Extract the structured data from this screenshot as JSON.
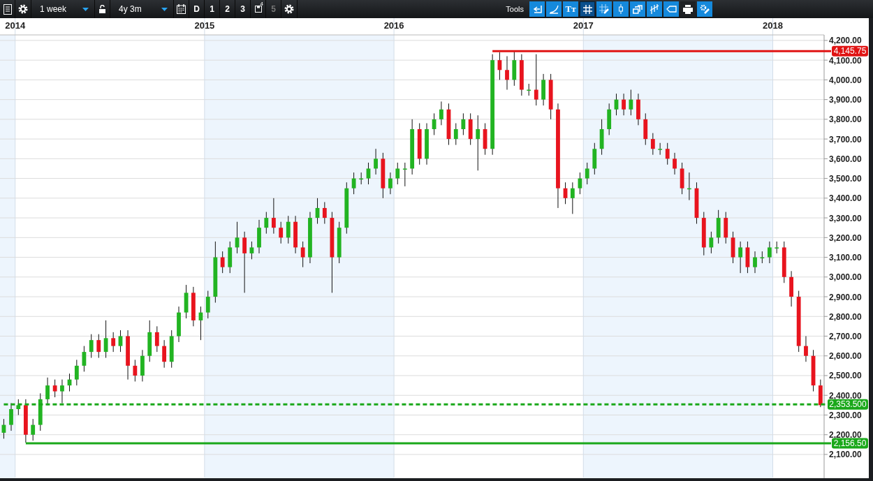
{
  "toolbar": {
    "left": [
      {
        "kind": "list"
      },
      {
        "kind": "gear"
      },
      {
        "kind": "dropdown",
        "value": "1 week"
      },
      {
        "kind": "lock"
      },
      {
        "kind": "dropdown",
        "value": "4y 3m"
      },
      {
        "kind": "calendar"
      },
      {
        "kind": "text",
        "label": "D",
        "disabled": false
      },
      {
        "kind": "text",
        "label": "1",
        "disabled": false
      },
      {
        "kind": "text",
        "label": "2",
        "disabled": false
      },
      {
        "kind": "text",
        "label": "3",
        "disabled": false
      },
      {
        "kind": "save",
        "badge": "4"
      },
      {
        "kind": "text",
        "label": "5",
        "disabled": true
      },
      {
        "kind": "gear"
      }
    ],
    "tools_label": "Tools",
    "tools": [
      {
        "kind": "back",
        "selected": false
      },
      {
        "kind": "curve",
        "selected": false
      },
      {
        "kind": "text",
        "label": "Tт",
        "selected": false
      },
      {
        "kind": "grid",
        "selected": true
      },
      {
        "kind": "grid-edit",
        "selected": false
      },
      {
        "kind": "candle",
        "selected": false
      },
      {
        "kind": "layers",
        "selected": false
      },
      {
        "kind": "bars",
        "selected": false
      },
      {
        "kind": "tag",
        "selected": false
      },
      {
        "kind": "print",
        "selected": false
      },
      {
        "kind": "settings",
        "selected": false
      }
    ]
  },
  "chart": {
    "chart_data": {
      "type": "candlestick",
      "grid": true,
      "xlim": [
        2013.92,
        2018.271
      ],
      "ylim": [
        1983,
        4228
      ],
      "xticks": [
        2014,
        2015,
        2016,
        2017,
        2018
      ],
      "yticks": [
        {
          "value": 4200,
          "label": "4,200.00"
        },
        {
          "value": 4100,
          "label": "4,100.00"
        },
        {
          "value": 4000,
          "label": "4,000.00"
        },
        {
          "value": 3900,
          "label": "3,900.00"
        },
        {
          "value": 3800,
          "label": "3,800.00"
        },
        {
          "value": 3700,
          "label": "3,700.00"
        },
        {
          "value": 3600,
          "label": "3,600.00"
        },
        {
          "value": 3500,
          "label": "3,500.00"
        },
        {
          "value": 3400,
          "label": "3,400.00"
        },
        {
          "value": 3300,
          "label": "3,300.00"
        },
        {
          "value": 3200,
          "label": "3,200.00"
        },
        {
          "value": 3100,
          "label": "3,100.00"
        },
        {
          "value": 3000,
          "label": "3,000.00"
        },
        {
          "value": 2900,
          "label": "2,900.00"
        },
        {
          "value": 2800,
          "label": "2,800.00"
        },
        {
          "value": 2700,
          "label": "2,700.00"
        },
        {
          "value": 2600,
          "label": "2,600.00"
        },
        {
          "value": 2500,
          "label": "2,500.00"
        },
        {
          "value": 2400,
          "label": "2,400.00"
        },
        {
          "value": 2300,
          "label": "2,300.00"
        },
        {
          "value": 2200,
          "label": "2,200.00"
        },
        {
          "value": 2100,
          "label": "2,100.00"
        }
      ],
      "x": [
        2013.94,
        2013.979,
        2014.017,
        2014.056,
        2014.094,
        2014.133,
        2014.171,
        2014.21,
        2014.248,
        2014.287,
        2014.325,
        2014.364,
        2014.402,
        2014.441,
        2014.479,
        2014.518,
        2014.556,
        2014.595,
        2014.633,
        2014.672,
        2014.71,
        2014.749,
        2014.787,
        2014.826,
        2014.864,
        2014.903,
        2014.941,
        2014.98,
        2015.018,
        2015.057,
        2015.095,
        2015.134,
        2015.172,
        2015.211,
        2015.249,
        2015.288,
        2015.326,
        2015.365,
        2015.403,
        2015.442,
        2015.48,
        2015.519,
        2015.557,
        2015.596,
        2015.634,
        2015.673,
        2015.711,
        2015.75,
        2015.788,
        2015.827,
        2015.865,
        2015.904,
        2015.942,
        2015.981,
        2016.019,
        2016.058,
        2016.096,
        2016.135,
        2016.173,
        2016.212,
        2016.25,
        2016.289,
        2016.327,
        2016.366,
        2016.404,
        2016.443,
        2016.481,
        2016.52,
        2016.558,
        2016.597,
        2016.635,
        2016.674,
        2016.712,
        2016.751,
        2016.789,
        2016.828,
        2016.866,
        2016.905,
        2016.943,
        2016.982,
        2017.02,
        2017.059,
        2017.097,
        2017.136,
        2017.174,
        2017.213,
        2017.251,
        2017.29,
        2017.328,
        2017.367,
        2017.405,
        2017.444,
        2017.482,
        2017.521,
        2017.559,
        2017.598,
        2017.636,
        2017.675,
        2017.713,
        2017.752,
        2017.79,
        2017.829,
        2017.867,
        2017.906,
        2017.944,
        2017.983,
        2018.021,
        2018.06,
        2018.098,
        2018.137,
        2018.175,
        2018.214,
        2018.252
      ],
      "ohlc": [
        [
          2210,
          2280,
          2180,
          2250
        ],
        [
          2250,
          2360,
          2220,
          2330
        ],
        [
          2330,
          2380,
          2300,
          2350
        ],
        [
          2350,
          2380,
          2160,
          2200
        ],
        [
          2200,
          2280,
          2170,
          2250
        ],
        [
          2250,
          2410,
          2220,
          2380
        ],
        [
          2380,
          2490,
          2350,
          2450
        ],
        [
          2450,
          2480,
          2390,
          2420
        ],
        [
          2420,
          2480,
          2360,
          2450
        ],
        [
          2450,
          2510,
          2420,
          2480
        ],
        [
          2480,
          2580,
          2450,
          2550
        ],
        [
          2550,
          2650,
          2520,
          2620
        ],
        [
          2620,
          2710,
          2590,
          2680
        ],
        [
          2680,
          2710,
          2590,
          2620
        ],
        [
          2620,
          2780,
          2590,
          2690
        ],
        [
          2690,
          2720,
          2620,
          2650
        ],
        [
          2650,
          2730,
          2620,
          2700
        ],
        [
          2700,
          2730,
          2480,
          2550
        ],
        [
          2550,
          2580,
          2470,
          2500
        ],
        [
          2500,
          2630,
          2470,
          2600
        ],
        [
          2600,
          2780,
          2570,
          2720
        ],
        [
          2720,
          2750,
          2620,
          2650
        ],
        [
          2650,
          2680,
          2540,
          2570
        ],
        [
          2570,
          2730,
          2540,
          2700
        ],
        [
          2700,
          2850,
          2670,
          2820
        ],
        [
          2820,
          2960,
          2790,
          2920
        ],
        [
          2920,
          2950,
          2750,
          2780
        ],
        [
          2780,
          2850,
          2680,
          2820
        ],
        [
          2820,
          2930,
          2790,
          2900
        ],
        [
          2900,
          3180,
          2870,
          3100
        ],
        [
          3100,
          3130,
          3020,
          3050
        ],
        [
          3050,
          3180,
          3020,
          3150
        ],
        [
          3150,
          3280,
          3120,
          3200
        ],
        [
          3200,
          3230,
          2920,
          3120
        ],
        [
          3120,
          3180,
          3090,
          3150
        ],
        [
          3150,
          3290,
          3120,
          3250
        ],
        [
          3250,
          3330,
          3220,
          3300
        ],
        [
          3300,
          3400,
          3220,
          3250
        ],
        [
          3250,
          3280,
          3170,
          3200
        ],
        [
          3200,
          3310,
          3170,
          3280
        ],
        [
          3280,
          3310,
          3120,
          3150
        ],
        [
          3150,
          3180,
          3050,
          3100
        ],
        [
          3100,
          3330,
          3070,
          3300
        ],
        [
          3300,
          3400,
          3270,
          3350
        ],
        [
          3350,
          3380,
          3270,
          3300
        ],
        [
          3300,
          3330,
          2920,
          3100
        ],
        [
          3100,
          3280,
          3070,
          3250
        ],
        [
          3250,
          3480,
          3220,
          3450
        ],
        [
          3450,
          3530,
          3420,
          3500
        ],
        [
          3500,
          3530,
          3470,
          3500
        ],
        [
          3500,
          3580,
          3470,
          3550
        ],
        [
          3550,
          3650,
          3520,
          3600
        ],
        [
          3600,
          3630,
          3400,
          3450
        ],
        [
          3450,
          3530,
          3420,
          3500
        ],
        [
          3500,
          3580,
          3470,
          3550
        ],
        [
          3550,
          3580,
          3460,
          3550
        ],
        [
          3550,
          3800,
          3520,
          3750
        ],
        [
          3750,
          3780,
          3570,
          3600
        ],
        [
          3600,
          3780,
          3570,
          3750
        ],
        [
          3750,
          3830,
          3720,
          3800
        ],
        [
          3800,
          3890,
          3770,
          3850
        ],
        [
          3850,
          3880,
          3670,
          3700
        ],
        [
          3700,
          3780,
          3670,
          3750
        ],
        [
          3750,
          3830,
          3720,
          3800
        ],
        [
          3800,
          3830,
          3670,
          3700
        ],
        [
          3700,
          3820,
          3540,
          3750
        ],
        [
          3750,
          3780,
          3620,
          3650
        ],
        [
          3650,
          4130,
          3620,
          4100
        ],
        [
          4100,
          4140,
          4000,
          4050
        ],
        [
          4050,
          4120,
          3950,
          4000
        ],
        [
          4000,
          4150,
          3970,
          4100
        ],
        [
          4100,
          4130,
          3920,
          3950
        ],
        [
          3950,
          3980,
          3920,
          3950
        ],
        [
          3950,
          4130,
          3870,
          3900
        ],
        [
          3900,
          4030,
          3870,
          4000
        ],
        [
          4000,
          4030,
          3800,
          3850
        ],
        [
          3850,
          3880,
          3350,
          3450
        ],
        [
          3450,
          3480,
          3370,
          3400
        ],
        [
          3400,
          3480,
          3320,
          3450
        ],
        [
          3450,
          3530,
          3420,
          3500
        ],
        [
          3500,
          3580,
          3470,
          3550
        ],
        [
          3550,
          3680,
          3520,
          3650
        ],
        [
          3650,
          3800,
          3620,
          3750
        ],
        [
          3750,
          3880,
          3720,
          3850
        ],
        [
          3850,
          3930,
          3820,
          3900
        ],
        [
          3900,
          3930,
          3820,
          3850
        ],
        [
          3850,
          3950,
          3820,
          3900
        ],
        [
          3900,
          3930,
          3770,
          3800
        ],
        [
          3800,
          3830,
          3670,
          3700
        ],
        [
          3700,
          3730,
          3620,
          3650
        ],
        [
          3650,
          3680,
          3620,
          3650
        ],
        [
          3650,
          3680,
          3570,
          3600
        ],
        [
          3600,
          3630,
          3520,
          3550
        ],
        [
          3550,
          3580,
          3420,
          3450
        ],
        [
          3450,
          3530,
          3390,
          3450
        ],
        [
          3450,
          3480,
          3270,
          3300
        ],
        [
          3300,
          3330,
          3110,
          3150
        ],
        [
          3150,
          3230,
          3120,
          3200
        ],
        [
          3200,
          3340,
          3170,
          3300
        ],
        [
          3300,
          3330,
          3170,
          3200
        ],
        [
          3200,
          3230,
          3070,
          3100
        ],
        [
          3100,
          3180,
          3020,
          3150
        ],
        [
          3150,
          3180,
          3020,
          3050
        ],
        [
          3050,
          3130,
          3020,
          3100
        ],
        [
          3100,
          3130,
          3070,
          3100
        ],
        [
          3100,
          3180,
          3070,
          3150
        ],
        [
          3150,
          3180,
          3120,
          3150
        ],
        [
          3150,
          3180,
          2970,
          3000
        ],
        [
          3000,
          3030,
          2850,
          2900
        ],
        [
          2900,
          2930,
          2620,
          2650
        ],
        [
          2650,
          2700,
          2570,
          2600
        ],
        [
          2600,
          2630,
          2420,
          2450
        ],
        [
          2450,
          2480,
          2340,
          2350
        ]
      ],
      "ref_lines": [
        {
          "axis": "y",
          "value": 4145.75,
          "label": "4,145.75",
          "color": "#e01414"
        },
        {
          "axis": "y",
          "value": 2353.5,
          "label": "2,353.500",
          "color": "#1aa81a"
        },
        {
          "axis": "y",
          "value": 2156.5,
          "label": "2,156.50",
          "color": "#1aa81a"
        }
      ]
    }
  }
}
